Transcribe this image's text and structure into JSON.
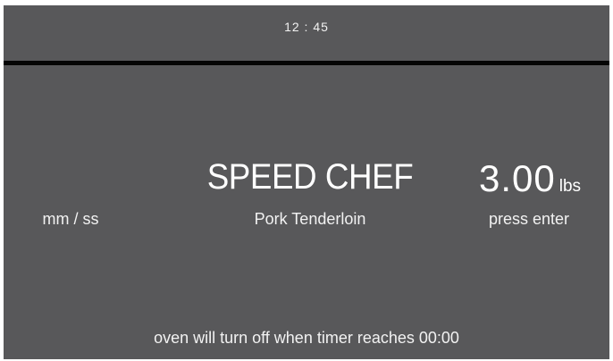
{
  "status_bar": {
    "clock": "12 : 45"
  },
  "main": {
    "title": "SPEED CHEF",
    "weight_value": "3.00",
    "weight_unit": "lbs",
    "time_format": "mm / ss",
    "recipe": "Pork Tenderloin",
    "prompt": "press enter"
  },
  "footer": {
    "message": "oven will turn off when timer reaches 00:00"
  },
  "colors": {
    "background": "#58585a",
    "divider": "#050505",
    "text": "#ffffff"
  }
}
